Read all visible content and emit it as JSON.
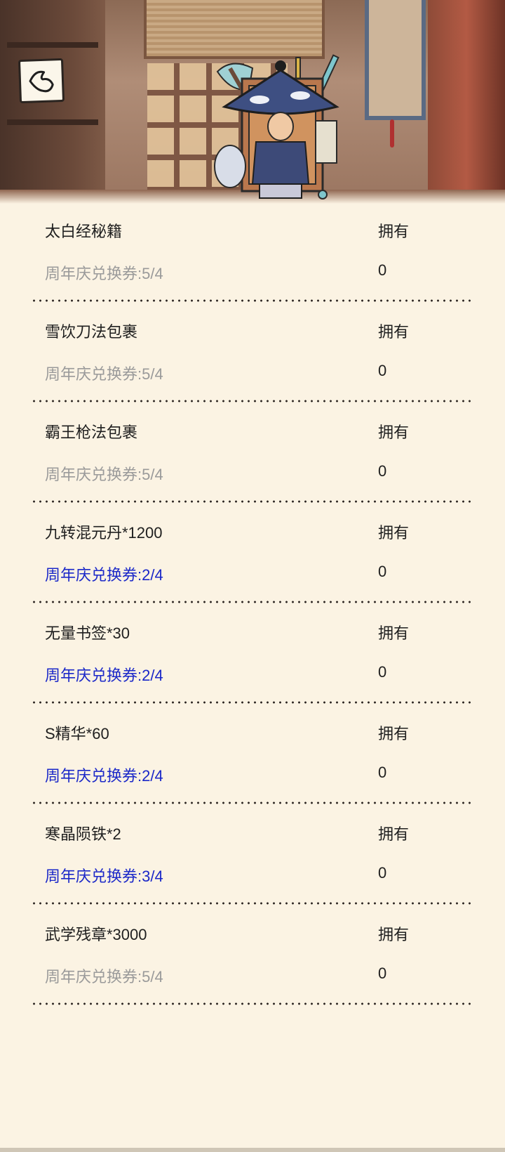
{
  "header": {
    "back_icon": "back-arrow-icon",
    "character": "merchant-character-illustration"
  },
  "items": [
    {
      "name": "太白经秘籍",
      "owned_label": "拥有",
      "cost": "周年庆兑换券:5/4",
      "owned": "0",
      "affordable": false
    },
    {
      "name": "雪饮刀法包裹",
      "owned_label": "拥有",
      "cost": "周年庆兑换券:5/4",
      "owned": "0",
      "affordable": false
    },
    {
      "name": "霸王枪法包裹",
      "owned_label": "拥有",
      "cost": "周年庆兑换券:5/4",
      "owned": "0",
      "affordable": false
    },
    {
      "name": "九转混元丹*1200",
      "owned_label": "拥有",
      "cost": "周年庆兑换券:2/4",
      "owned": "0",
      "affordable": true
    },
    {
      "name": "无量书签*30",
      "owned_label": "拥有",
      "cost": "周年庆兑换券:2/4",
      "owned": "0",
      "affordable": true
    },
    {
      "name": "S精华*60",
      "owned_label": "拥有",
      "cost": "周年庆兑换券:2/4",
      "owned": "0",
      "affordable": true
    },
    {
      "name": "寒晶陨铁*2",
      "owned_label": "拥有",
      "cost": "周年庆兑换券:3/4",
      "owned": "0",
      "affordable": true
    },
    {
      "name": "武学残章*3000",
      "owned_label": "拥有",
      "cost": "周年庆兑换券:5/4",
      "owned": "0",
      "affordable": false
    }
  ],
  "colors": {
    "background": "#fbf3e3",
    "text": "#1f1f1f",
    "cost_insufficient": "#9a9a9a",
    "cost_sufficient": "#1b28c8"
  }
}
